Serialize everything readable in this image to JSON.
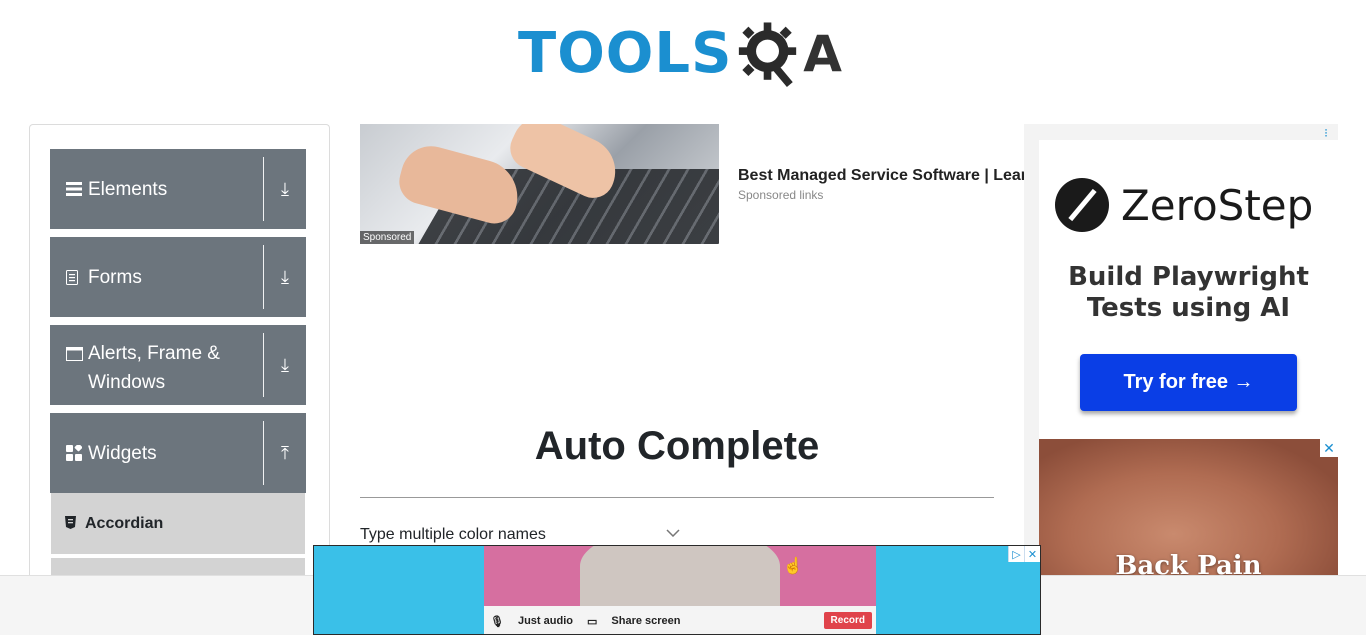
{
  "header": {
    "logo_text_left": "TOOLS",
    "logo_text_right": "A"
  },
  "sidebar": {
    "groups": [
      {
        "label": "Elements",
        "icon": "menu-icon",
        "toggle": "download-arrow-icon"
      },
      {
        "label": "Forms",
        "icon": "document-icon",
        "toggle": "download-arrow-icon"
      },
      {
        "label": "Alerts, Frame & Windows",
        "icon": "window-icon",
        "toggle": "download-arrow-icon"
      },
      {
        "label": "Widgets",
        "icon": "widgets-icon",
        "toggle": "upload-arrow-icon"
      }
    ],
    "items": [
      {
        "label": "Accordian",
        "icon": "html5-icon"
      }
    ]
  },
  "ads": {
    "sponsored": {
      "tag": "Sponsored",
      "title": "Best Managed Service Software | Learn More",
      "subtitle": "Sponsored links"
    },
    "right": {
      "brand": "ZeroStep",
      "tagline": "Build Playwright Tests using AI",
      "cta": "Try for free →",
      "photo_caption": "Back Pain"
    },
    "bottom": {
      "audio_label": "Just audio",
      "share_label": "Share screen",
      "record_label": "Record"
    }
  },
  "main": {
    "title": "Auto Complete",
    "field_label": "Type multiple color names"
  },
  "colors": {
    "brand_blue": "#1b8fd0",
    "sidebar_group": "#6c757d",
    "sidebar_item": "#d3d3d3",
    "cta_blue": "#0a3ee6"
  }
}
